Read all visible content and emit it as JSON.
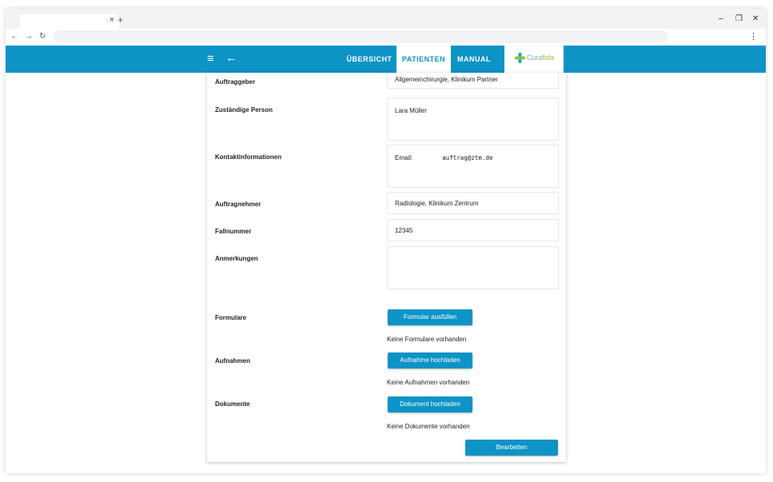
{
  "browser": {
    "tab_close": "×",
    "new_tab": "+",
    "minimize": "–",
    "maximize": "❐",
    "close": "✕",
    "back": "←",
    "forward": "→",
    "reload": "↻",
    "menu": "⋮"
  },
  "appbar": {
    "menu_icon": "≡",
    "back_icon": "←",
    "tabs": [
      "ÜBERSICHT",
      "PATIENTEN",
      "MANUAL"
    ],
    "active_tab": "PATIENTEN",
    "logo_part1": "Cura",
    "logo_part2": "fida",
    "accent_color": "#0d93c6"
  },
  "form": {
    "auftraggeber_label": "Auftraggeber",
    "auftraggeber_value": "Allgemeinchirurgie, Klinikum Partner",
    "person_label": "Zuständige Person",
    "person_value": "Lara Müller",
    "kontakt_label": "Kontaktinformationen",
    "email_label": "Email:",
    "email_value": "auftrag@ztm.de",
    "auftragnehmer_label": "Auftragnehmer",
    "auftragnehmer_value": "Radiologie, Klinikum Zentrum",
    "fallnummer_label": "Fallnummer",
    "fallnummer_value": "12345",
    "anmerkungen_label": "Anmerkungen",
    "anmerkungen_value": "",
    "formulare_label": "Formulare",
    "formulare_button": "Formular ausfüllen",
    "formulare_note": "Keine Formulare vorhanden",
    "aufnahmen_label": "Aufnahmen",
    "aufnahmen_button": "Aufnahme hochladen",
    "aufnahmen_note": "Keine Aufnahmen vorhanden",
    "dokumente_label": "Dokumente",
    "dokumente_button": "Dokument hochladen",
    "dokumente_note": "Keine Dokumente vorhanden",
    "edit_button": "Bearbeiten"
  }
}
